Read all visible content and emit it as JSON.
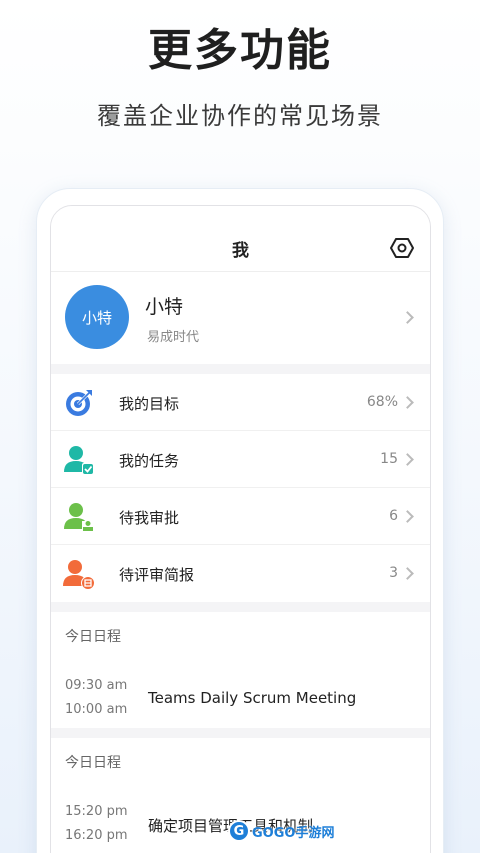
{
  "hero": {
    "title": "更多功能",
    "subtitle": "覆盖企业协作的常见场景"
  },
  "nav": {
    "title": "我",
    "settings_icon": "gear-hexagon-icon"
  },
  "profile": {
    "avatar_text": "小特",
    "avatar_color": "#3a8de0",
    "name": "小特",
    "org": "易成时代"
  },
  "menu": [
    {
      "label": "我的目标",
      "value": "68%",
      "icon": "target-icon",
      "color": "#3a7be0"
    },
    {
      "label": "我的任务",
      "value": "15",
      "icon": "task-person-icon",
      "color": "#1fb8a6"
    },
    {
      "label": "待我审批",
      "value": "6",
      "icon": "approval-person-icon",
      "color": "#6cc04a"
    },
    {
      "label": "待评审简报",
      "value": "3",
      "icon": "report-person-icon",
      "color": "#f26b3a"
    }
  ],
  "schedules": [
    {
      "heading": "今日日程",
      "start": "09:30 am",
      "end": "10:00 am",
      "event": "Teams Daily Scrum Meeting"
    },
    {
      "heading": "今日日程",
      "start": "15:20 pm",
      "end": "16:20 pm",
      "event": "确定项目管理工具和机制"
    }
  ],
  "watermark": {
    "text": "GOGO手游网",
    "logo": "G"
  }
}
